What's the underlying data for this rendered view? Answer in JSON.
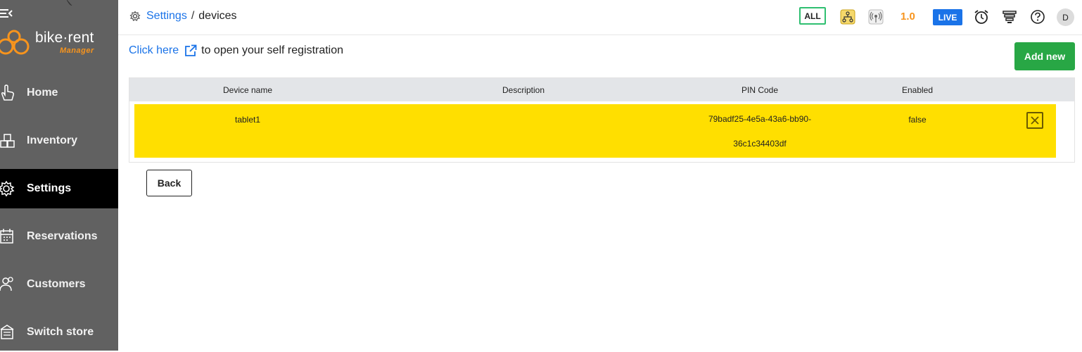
{
  "app": {
    "logo_word": "bike·rent",
    "logo_sub": "Manager"
  },
  "sidebar": {
    "items": [
      {
        "label": "Home",
        "icon": "hand-pointer-icon"
      },
      {
        "label": "Inventory",
        "icon": "boxes-icon"
      },
      {
        "label": "Settings",
        "icon": "gear-icon",
        "active": true
      },
      {
        "label": "Reservations",
        "icon": "calendar-icon"
      },
      {
        "label": "Customers",
        "icon": "users-icon"
      },
      {
        "label": "Switch store",
        "icon": "store-icon"
      }
    ]
  },
  "header": {
    "breadcrumb_root": "Settings",
    "breadcrumb_sep": "/",
    "breadcrumb_current": "devices",
    "all_label": "ALL",
    "version": "1.0",
    "live_label": "LIVE",
    "avatar_initial": "D"
  },
  "main": {
    "click_here": "Click here",
    "self_registration_text": "to open your self registration",
    "add_new_label": "Add new",
    "back_label": "Back",
    "table": {
      "columns": [
        "Device name",
        "Description",
        "PIN Code",
        "Enabled"
      ],
      "rows": [
        {
          "device_name": "tablet1",
          "description": "",
          "pin_line1": "79badf25-4e5a-43a6-bb90-",
          "pin_line2": "36c1c34403df",
          "enabled": "false"
        }
      ]
    }
  },
  "colors": {
    "sidebar_bg": "#616161",
    "active_bg": "#000000",
    "accent_orange": "#f7941d",
    "link_blue": "#1a73e8",
    "add_green": "#28a745",
    "row_highlight": "#ffdf00"
  }
}
